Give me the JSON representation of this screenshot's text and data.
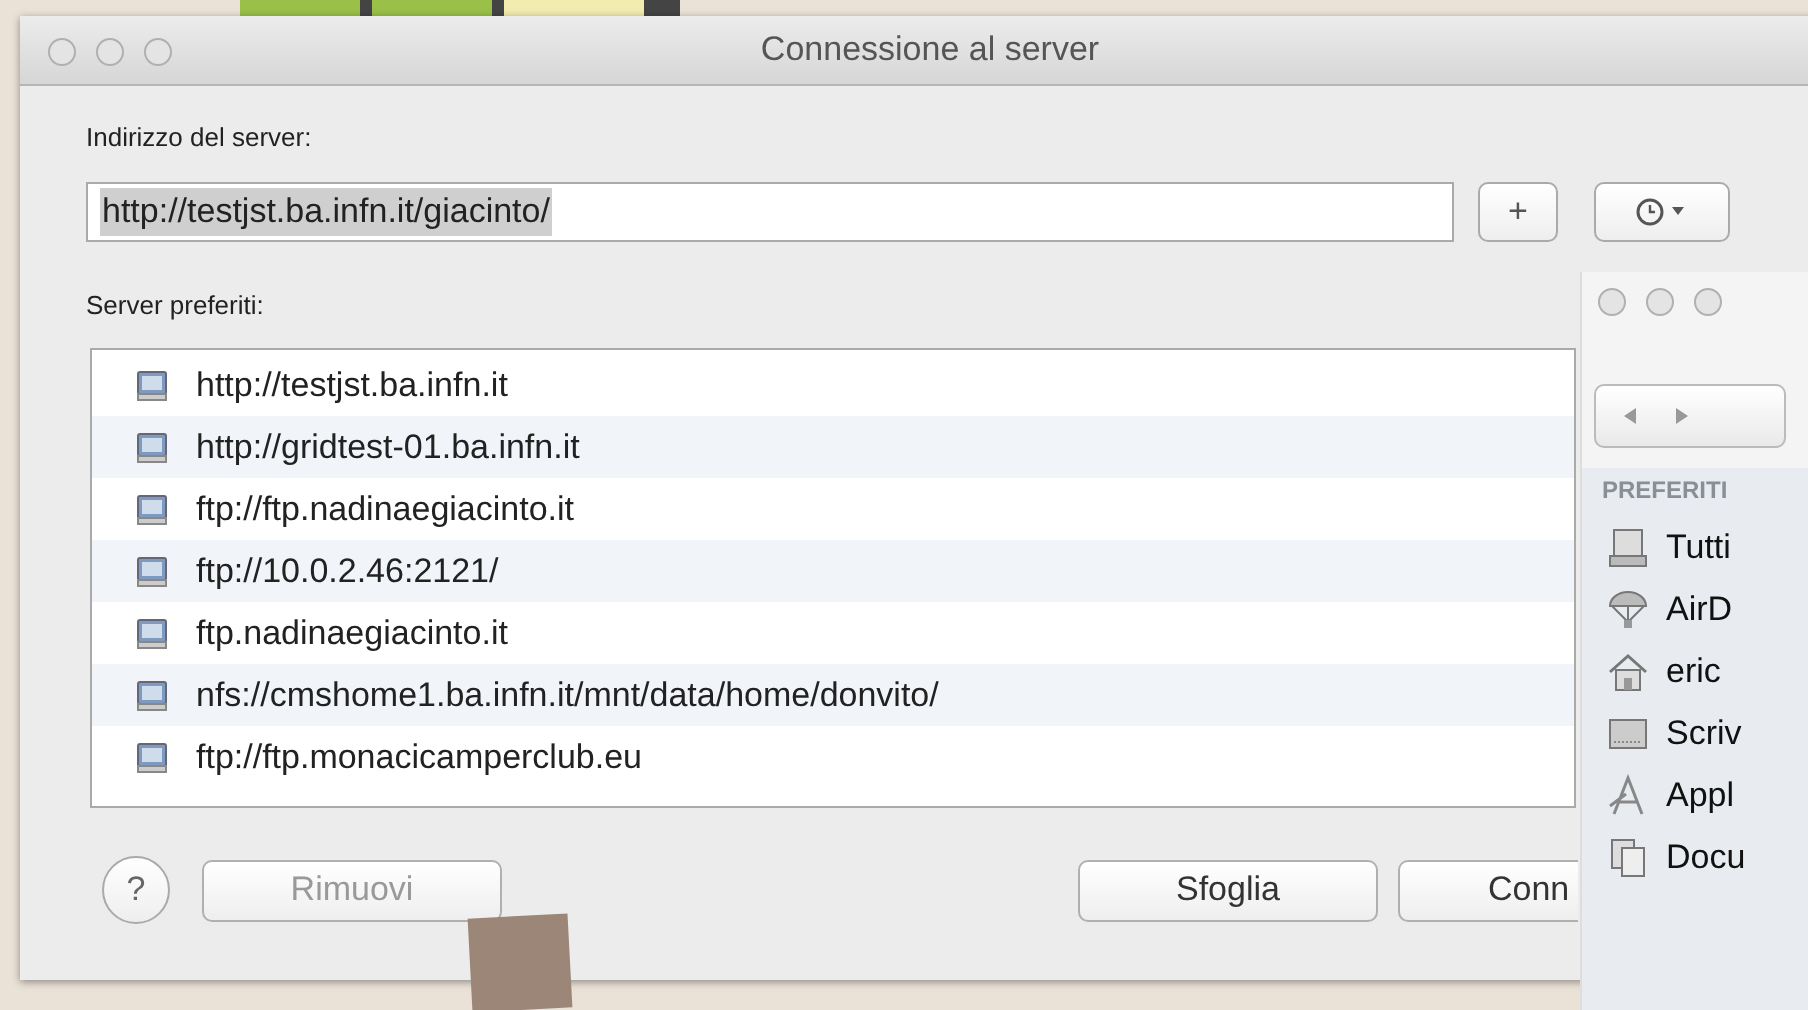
{
  "dialog": {
    "title": "Connessione al server",
    "address_label": "Indirizzo del server:",
    "address": {
      "value": "http://testjst.ba.infn.it/giacinto/",
      "text_selected": true
    },
    "add_button": "+",
    "favorites_label": "Server preferiti:",
    "favorites": [
      "http://testjst.ba.infn.it",
      "http://gridtest-01.ba.infn.it",
      "ftp://ftp.nadinaegiacinto.it",
      "ftp://10.0.2.46:2121/",
      "ftp.nadinaegiacinto.it",
      "nfs://cmshome1.ba.infn.it/mnt/data/home/donvito/",
      "ftp://ftp.monacicamperclub.eu"
    ],
    "help_button": "?",
    "buttons": [
      {
        "label": "Rimuovi",
        "disabled": true
      },
      {
        "label": "Sfoglia",
        "disabled": false
      },
      {
        "label": "Conn",
        "disabled": false
      }
    ]
  },
  "finder": {
    "section": "PREFERITI",
    "items": [
      {
        "label": "Tutti",
        "kind": "drive"
      },
      {
        "label": "AirD",
        "kind": "airdrop"
      },
      {
        "label": "eric",
        "kind": "home"
      },
      {
        "label": "Scriv",
        "kind": "desktop"
      },
      {
        "label": "Appl",
        "kind": "apps"
      },
      {
        "label": "Docu",
        "kind": "docs"
      }
    ]
  }
}
